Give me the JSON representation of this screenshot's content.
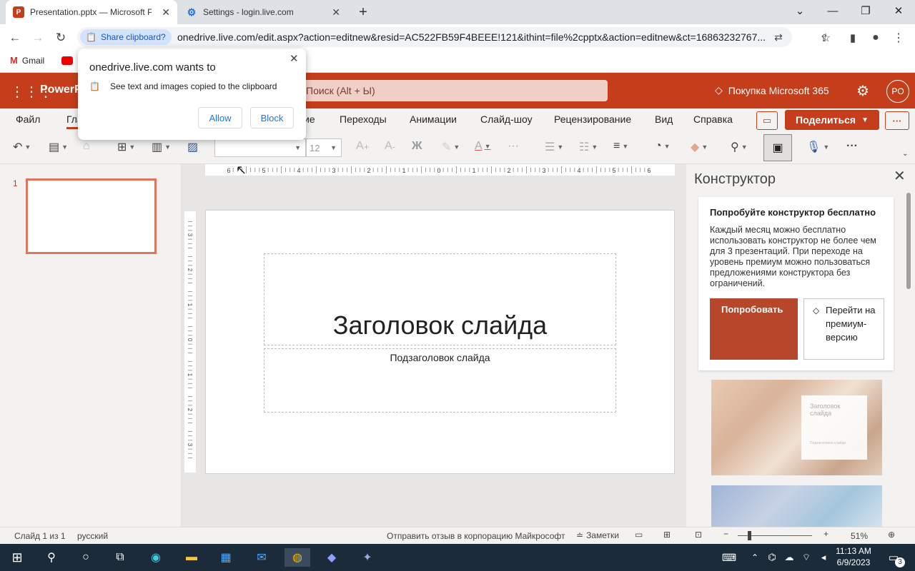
{
  "browser": {
    "tabs": [
      {
        "title": "Presentation.pptx — Microsoft P",
        "active": true
      },
      {
        "title": "Settings - login.live.com",
        "active": false
      }
    ],
    "share_chip": "Share clipboard?",
    "url": "onedrive.live.com/edit.aspx?action=editnew&resid=AC522FB59F4BEEE!121&ithint=file%2cpptx&action=editnew&ct=16863232767...",
    "bookmarks": [
      "Gmail"
    ]
  },
  "popup": {
    "title": "onedrive.live.com wants to",
    "permission": "See text and images copied to the clipboard",
    "allow": "Allow",
    "block": "Block"
  },
  "office": {
    "app": "PowerP",
    "search_placeholder": "Поиск (Alt + Ы)",
    "premium": "Покупка Microsoft 365",
    "avatar": "PO",
    "ribbon_tabs": [
      "Файл",
      "Гла",
      "ие",
      "Переходы",
      "Анимации",
      "Слайд-шоу",
      "Рецензирование",
      "Вид",
      "Справка"
    ],
    "share_label": "Поделиться",
    "font_size": "12"
  },
  "ruler": {
    "h_labels": [
      "6",
      "5",
      "4",
      "3",
      "2",
      "1",
      "0",
      "1",
      "2",
      "3",
      "4",
      "5",
      "6"
    ],
    "v_labels": [
      "3",
      "2",
      "1",
      "0",
      "1",
      "2",
      "3"
    ]
  },
  "slides": {
    "number": "1"
  },
  "slide": {
    "title": "Заголовок слайда",
    "subtitle": "Подзаголовок слайда"
  },
  "designer": {
    "title": "Конструктор",
    "card_title": "Попробуйте конструктор бесплатно",
    "card_text": "Каждый месяц можно бесплатно использовать конструктор не более чем для 3 презентаций. При переходе на уровень премиум можно пользоваться предложениями конструктора без ограничений.",
    "try_label": "Попробовать",
    "premium_label": "Перейти на премиум-версию",
    "preview_title": "Заголовок слайда",
    "preview_sub": "Подзаголовок слайда"
  },
  "status": {
    "slide_info": "Слайд 1 из 1",
    "language": "русский",
    "feedback": "Отправить отзыв в корпорацию Майкрософт",
    "notes": "Заметки",
    "zoom": "51%"
  },
  "taskbar": {
    "time": "11:13 AM",
    "date": "6/9/2023",
    "notifications": "3"
  }
}
